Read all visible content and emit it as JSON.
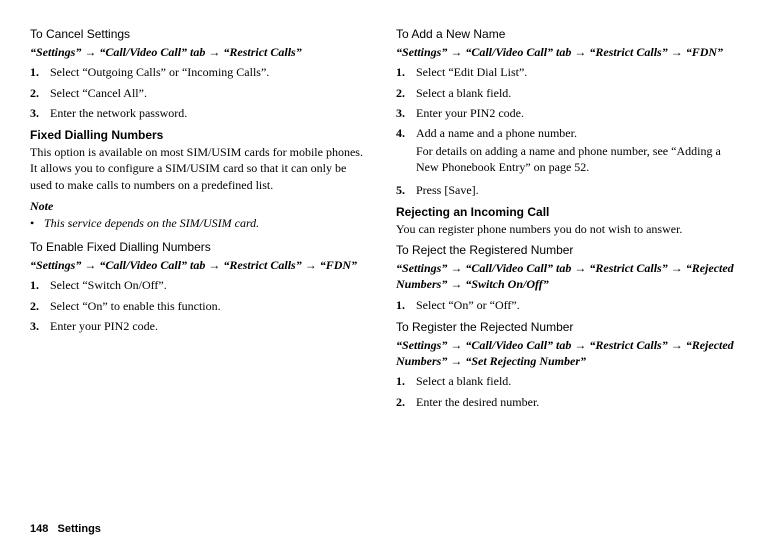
{
  "left": {
    "cancel": {
      "title": "To Cancel Settings",
      "path": "“Settings” → “Call/Video Call” tab → “Restrict Calls”",
      "steps": [
        "Select “Outgoing Calls” or “Incoming Calls”.",
        "Select “Cancel All”.",
        "Enter the network password."
      ]
    },
    "fdn": {
      "title": "Fixed Dialling Numbers",
      "body": "This option is available on most SIM/USIM cards for mobile phones. It allows you to configure a SIM/USIM card so that it can only be used to make calls to numbers on a predefined list.",
      "note_head": "Note",
      "note_body": "This service depends on the SIM/USIM card."
    },
    "enable": {
      "title": "To Enable Fixed Dialling Numbers",
      "path": "“Settings” → “Call/Video Call” tab → “Restrict Calls” → “FDN”",
      "steps": [
        "Select “Switch On/Off”.",
        "Select “On” to enable this function.",
        "Enter your PIN2 code."
      ]
    }
  },
  "right": {
    "add": {
      "title": "To Add a New Name",
      "path": "“Settings” → “Call/Video Call” tab → “Restrict Calls” → “FDN”",
      "steps": [
        "Select “Edit Dial List”.",
        "Select a blank field.",
        "Enter your PIN2 code.",
        "Add a name and a phone number.",
        "Press [Save]."
      ],
      "subnote": "For details on adding a name and phone number, see “Adding a New Phonebook Entry” on page 52."
    },
    "reject": {
      "title": "Rejecting an Incoming Call",
      "body": "You can register phone numbers you do not wish to answer."
    },
    "rejectReg": {
      "title": "To Reject the Registered Number",
      "path": "“Settings” → “Call/Video Call” tab → “Restrict Calls” → “Rejected Numbers” → “Switch On/Off”",
      "steps": [
        "Select “On” or “Off”."
      ]
    },
    "regRej": {
      "title": "To Register the Rejected Number",
      "path": "“Settings” → “Call/Video Call” tab → “Restrict Calls” → “Rejected Numbers” → “Set Rejecting Number”",
      "steps": [
        "Select a blank field.",
        "Enter the desired number."
      ]
    }
  },
  "footer": {
    "page": "148",
    "section": "Settings"
  }
}
